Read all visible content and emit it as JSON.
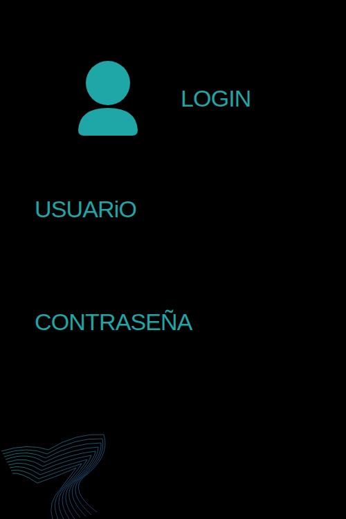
{
  "header": {
    "title": "LOGIN"
  },
  "fields": [
    {
      "label": "USUARiO"
    },
    {
      "label": "CONTRASEÑA"
    }
  ]
}
